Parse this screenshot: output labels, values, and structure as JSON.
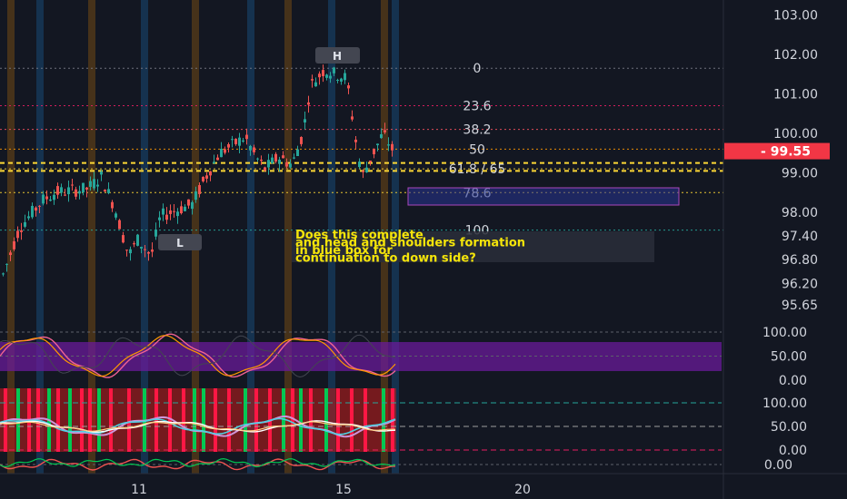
{
  "chart_data": [
    {
      "type": "candlestick",
      "yaxis_ticks": [
        "103.00",
        "102.00",
        "101.00",
        "100.00",
        "99.00",
        "98.00",
        "97.40",
        "96.80",
        "96.20",
        "95.65"
      ],
      "xaxis_ticks": [
        "11",
        "15",
        "20"
      ],
      "current_price": "99.55",
      "fib_levels": [
        {
          "label": "0",
          "price": 101.65
        },
        {
          "label": "23.6",
          "price": 100.7
        },
        {
          "label": "38.2",
          "price": 100.1
        },
        {
          "label": "50",
          "price": 99.6
        },
        {
          "label": "61.8 / 65",
          "price": 99.1
        },
        {
          "label": "78.6",
          "price": 98.5
        },
        {
          "label": "100",
          "price": 97.55
        }
      ],
      "markers": [
        {
          "label": "H",
          "role": "swing-high"
        },
        {
          "label": "L",
          "role": "swing-low"
        }
      ],
      "annotation": [
        "Does this complete",
        " and head and shoulders formation",
        "in blue box for",
        "continuation to down side?"
      ],
      "colors": {
        "up": "#26a69a",
        "down": "#ef5350",
        "accent_purple": "#6a1b9a",
        "price_tag": "#f23645",
        "note_text": "#f5e50a"
      }
    },
    {
      "type": "line",
      "name_hint": "oscillator-1",
      "yaxis_ticks": [
        "100.00",
        "50.00",
        "0.00"
      ]
    },
    {
      "type": "line",
      "name_hint": "oscillator-2",
      "yaxis_ticks": [
        "100.00",
        "50.00",
        "0.00"
      ]
    },
    {
      "type": "line",
      "name_hint": "oscillator-3",
      "yaxis_ticks": [
        "0.00"
      ]
    }
  ]
}
